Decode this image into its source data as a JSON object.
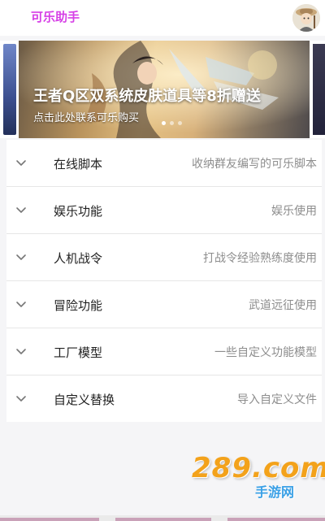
{
  "app": {
    "title": "可乐助手"
  },
  "banner": {
    "title": "王者Q区双系统皮肤道具等8折赠送",
    "subtitle": "点击此处联系可乐购买"
  },
  "menu": {
    "items": [
      {
        "title": "在线脚本",
        "desc": "收纳群友编写的可乐脚本",
        "icon": "chevron-down-icon"
      },
      {
        "title": "娱乐功能",
        "desc": "娱乐使用",
        "icon": "chevron-down-icon"
      },
      {
        "title": "人机战令",
        "desc": "打战令经验熟练度使用",
        "icon": "chevron-down-icon"
      },
      {
        "title": "冒险功能",
        "desc": "武道远征使用",
        "icon": "chevron-down-icon"
      },
      {
        "title": "工厂模型",
        "desc": "一些自定义功能模型",
        "icon": "chevron-down-icon"
      },
      {
        "title": "自定义替换",
        "desc": "导入自定义文件",
        "icon": "chevron-down-icon"
      }
    ]
  },
  "watermark": {
    "main": "289.com",
    "sub": "手游网"
  },
  "colors": {
    "accent": "#d63fe6",
    "watermark_orange": "#f3a21b",
    "watermark_blue": "#3aa0e6"
  }
}
